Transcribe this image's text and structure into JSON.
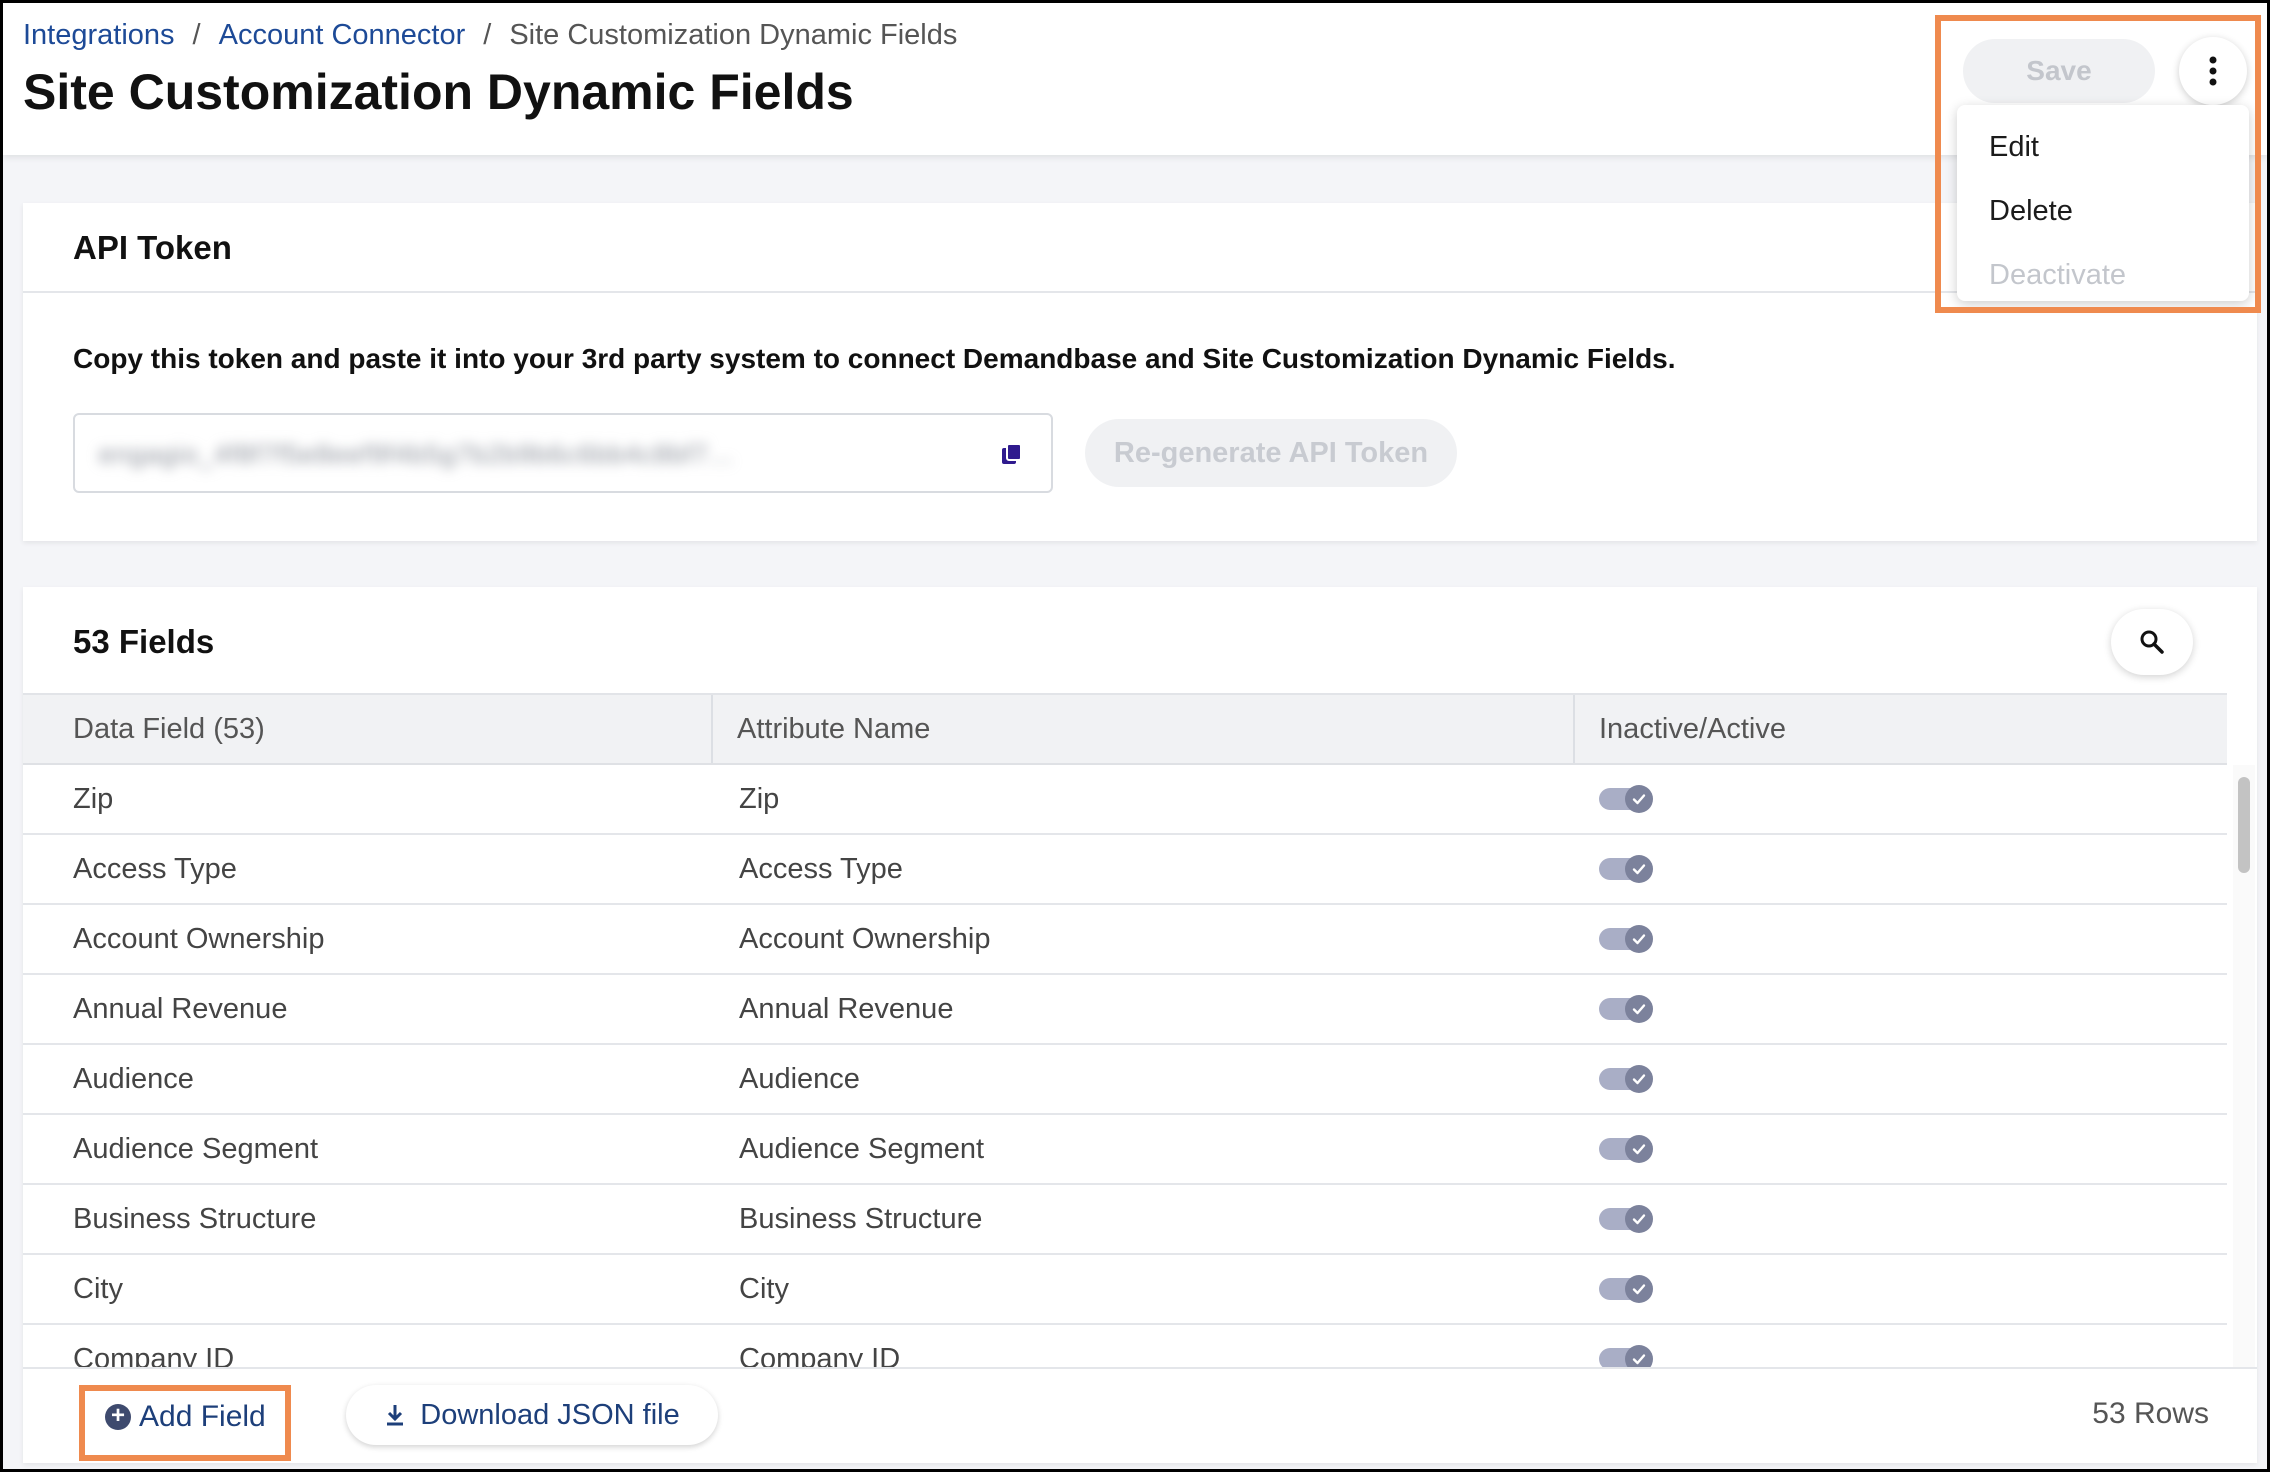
{
  "breadcrumb": {
    "items": [
      "Integrations",
      "Account Connector"
    ],
    "separator": "/",
    "current": "Site Customization Dynamic Fields"
  },
  "page": {
    "title": "Site Customization Dynamic Fields"
  },
  "toolbar": {
    "save_label": "Save",
    "more_icon": "vertical-ellipsis-icon",
    "menu": [
      "Edit",
      "Delete",
      "Deactivate"
    ],
    "menu_disabled": [
      "Deactivate"
    ]
  },
  "token": {
    "title": "API Token",
    "description": "Copy this token and paste it into your 3rd party system to connect Demandbase and Site Customization Dynamic Fields.",
    "value": "engagio_4f8f7f5e8eef9f4b5g7b2b9b6c6bb4c8bf7...",
    "copy_icon": "copy-icon",
    "regen_label": "Re-generate API Token"
  },
  "fields": {
    "title": "53 Fields",
    "search_icon": "search-icon",
    "columns": [
      "Data Field (53)",
      "Attribute Name",
      "Inactive/Active"
    ],
    "rows": [
      {
        "field": "Zip",
        "attribute": "Zip",
        "active": true
      },
      {
        "field": "Access Type",
        "attribute": "Access Type",
        "active": true
      },
      {
        "field": "Account Ownership",
        "attribute": "Account Ownership",
        "active": true
      },
      {
        "field": "Annual Revenue",
        "attribute": "Annual Revenue",
        "active": true
      },
      {
        "field": "Audience",
        "attribute": "Audience",
        "active": true
      },
      {
        "field": "Audience Segment",
        "attribute": "Audience Segment",
        "active": true
      },
      {
        "field": "Business Structure",
        "attribute": "Business Structure",
        "active": true
      },
      {
        "field": "City",
        "attribute": "City",
        "active": true
      },
      {
        "field": "Company ID",
        "attribute": "Company ID",
        "active": true
      }
    ],
    "add_label": "Add Field",
    "download_label": "Download JSON file",
    "rows_count": "53 Rows"
  },
  "colors": {
    "link": "#1d4a97",
    "highlight": "#ef8a4e",
    "toggle_track": "#a9aec6",
    "toggle_knob": "#7c829c"
  }
}
